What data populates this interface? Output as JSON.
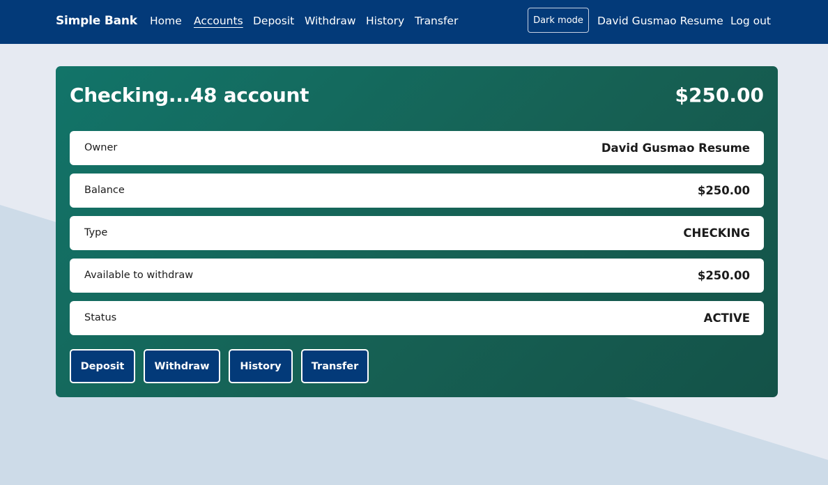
{
  "nav": {
    "brand": "Simple Bank",
    "links": [
      "Home",
      "Accounts",
      "Deposit",
      "Withdraw",
      "History",
      "Transfer"
    ],
    "active_link": "Accounts",
    "dark_mode_label": "Dark mode",
    "user_name": "David Gusmao Resume",
    "logout_label": "Log out"
  },
  "account": {
    "title": "Checking...48 account",
    "balance_display": "$250.00",
    "rows": [
      {
        "label": "Owner",
        "value": "David Gusmao Resume"
      },
      {
        "label": "Balance",
        "value": "$250.00"
      },
      {
        "label": "Type",
        "value": "CHECKING"
      },
      {
        "label": "Available to withdraw",
        "value": "$250.00"
      },
      {
        "label": "Status",
        "value": "ACTIVE"
      }
    ],
    "actions": [
      "Deposit",
      "Withdraw",
      "History",
      "Transfer"
    ]
  },
  "colors": {
    "navbar": "#033a79",
    "card_gradient_start": "#127469",
    "card_gradient_end": "#145248",
    "page_background": "#e6eaf2",
    "page_shape": "#cddbe8"
  }
}
